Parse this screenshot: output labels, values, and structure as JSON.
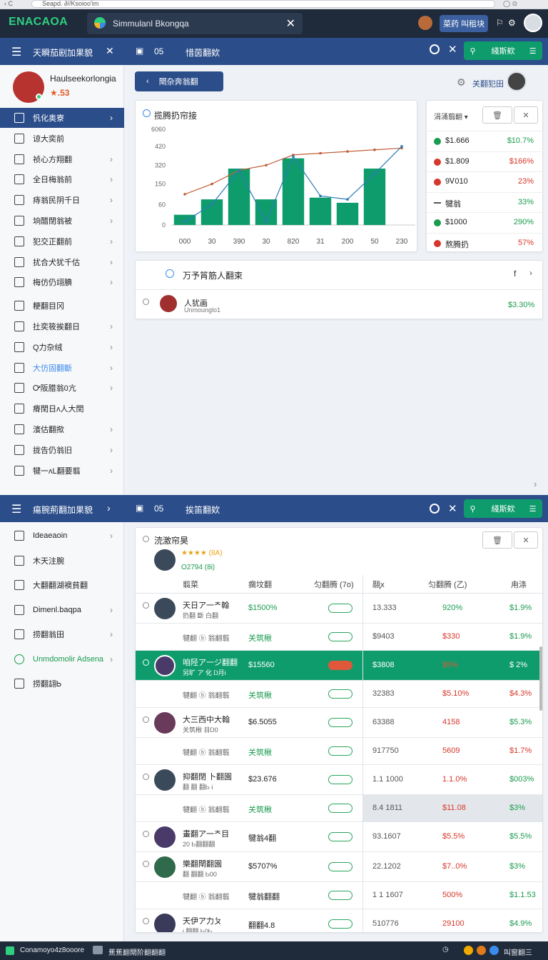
{
  "browser": {
    "url": "Seapd. ∂//Ksoioo'im"
  },
  "app": {
    "brand": "ENACAOA",
    "tab_title": "Simmulanl Bkongqa",
    "top_button": "菜药 叫租块"
  },
  "panel1": {
    "sidebar_title": "天瞬茄剧加果貌",
    "header_count": "05",
    "header_title": "惜茵翻欸",
    "search_label": "綫斯欸",
    "profile": {
      "name": "Haulseekorlongia",
      "score": "★.53"
    },
    "nav": [
      {
        "label": "忛化奥寮",
        "active": true
      },
      {
        "label": "谅大奕前"
      },
      {
        "label": "祯心方翔翻"
      },
      {
        "label": "全日梅翁前"
      },
      {
        "label": "痔翁民阴千日"
      },
      {
        "label": "垧醋閉翁被"
      },
      {
        "label": "犯交正翻前"
      },
      {
        "label": "扰合犬犹千估"
      },
      {
        "label": "梅仿仍翊腆"
      },
      {
        "label": "粳翻目冈"
      },
      {
        "label": "扗奕筱挨翻日"
      },
      {
        "label": "Q力杂绒"
      },
      {
        "label": "大仿固翻斷",
        "highlight": true
      },
      {
        "label": "Ꭴ阪腊翁0亢"
      },
      {
        "label": "瘠閏日ᴧ人大閏"
      },
      {
        "label": "濱估翻揿"
      },
      {
        "label": "拢告仍翁旧"
      },
      {
        "label": "犍一ᴧL翻要翦"
      }
    ],
    "back_button": "閛杂奔翁翻",
    "user_label": "关翻犯田",
    "chart": {
      "title": "揽腾扔帘接",
      "yticks": [
        "6060",
        "420",
        "320",
        "150",
        "60",
        "0"
      ],
      "xticks": [
        "000",
        "30",
        "390",
        "30",
        "820",
        "31",
        "200",
        "50",
        "230"
      ]
    },
    "chart_data": {
      "type": "bar",
      "categories": [
        "000",
        "30",
        "390",
        "30",
        "820",
        "31",
        "200",
        "50",
        "230"
      ],
      "series": [
        {
          "values": [
            60,
            150,
            330,
            150,
            390,
            160,
            130,
            330,
            0
          ]
        }
      ],
      "line_series": [
        {
          "values": [
            180,
            240,
            320,
            350,
            410,
            420,
            430,
            440,
            450
          ]
        },
        {
          "values": [
            20,
            120,
            320,
            20,
            400,
            170,
            150,
            300,
            460
          ]
        }
      ],
      "ylim": [
        0,
        560
      ]
    },
    "side_list": {
      "filter": "涓涌翦翻",
      "items": [
        {
          "icon": "globe-icon",
          "value": "$1.666",
          "change": "$10.7%",
          "color": "#1a9c4e"
        },
        {
          "icon": "tag-icon",
          "value": "$1.809",
          "change": "$166%",
          "color": "#d6372b"
        },
        {
          "icon": "tag-icon",
          "value": "9Ꮩ010",
          "change": "23%",
          "color": "#d6372b"
        },
        {
          "icon": "dash-icon",
          "value": "犍翁",
          "change": "33%",
          "color": "#1a9c4e"
        },
        {
          "icon": "tag-icon",
          "value": "$1000",
          "change": "290%",
          "color": "#1a9c4e"
        },
        {
          "icon": "circle-icon",
          "value": "熬腾扔",
          "change": "57%",
          "color": "#d6372b"
        }
      ]
    },
    "activity": {
      "title": "万予筲筋人翻束",
      "person_name": "人犹画",
      "person_sub": "Unmounglo1",
      "person_value": "$3.30%"
    }
  },
  "panel2": {
    "sidebar_title": "瘍腕荊翻加果貌",
    "header_count": "05",
    "header_title": "挨笛翻欸",
    "search_label": "綫斯欸",
    "nav": [
      {
        "label": "Ideaeaoin",
        "chev": true
      },
      {
        "label": "木天注腕"
      },
      {
        "label": "大翻翻湖襖貧翻"
      },
      {
        "label": "Dimenl.baqpa",
        "chev": true
      },
      {
        "label": "捞翻翁田",
        "chev": true
      },
      {
        "label": "Unmdomolir Adsena",
        "chev": true,
        "green": true
      },
      {
        "label": "捞翻翃Ꮟ"
      }
    ],
    "table_card": {
      "title": "涜激帘昊",
      "rating": "★★★★ (8A)",
      "sub": "O2794 (8Ꭵ)"
    },
    "columns": [
      "翦菜",
      "瘸坟翻",
      "匀翻腾 (7o)",
      "翮ꭗ",
      "匀翻腾 (乙)",
      "甪涤"
    ],
    "rows": [
      {
        "name": "天日ア一ᄎ翰",
        "sub": "扔翻 斷 白翻",
        "v1": "$1500%",
        "v2": "13.333",
        "v3": "920%",
        "v4": "$1.9%",
        "c1": "green",
        "c3": "green",
        "c4": "green"
      },
      {
        "name": "",
        "sub": "犍翻 ⓑ 翁翻翦",
        "v1": "关筑楸",
        "v2": "$9403",
        "v3": "$330",
        "v4": "$1.9%",
        "c1": "green",
        "c3": "red",
        "c4": "green",
        "sub_row": true
      },
      {
        "name": "咱陉ア一ジ翻翻",
        "sub": "另旷 ア 化 Ꭰ月Ꭵ",
        "v1": "$15560",
        "v2": "$3808",
        "v3": "$5%",
        "v4": "$ 2%",
        "selected": true
      },
      {
        "name": "",
        "sub": "犍翻 ⓑ 翁翻翦",
        "v1": "关筑楸",
        "v2": "32383",
        "v3": "$5.10%",
        "v4": "$4.3%",
        "c1": "green",
        "c3": "red",
        "c4": "red",
        "sub_row": true
      },
      {
        "name": "大三西中大翰",
        "sub": "关筑楸 目Ꭰ0",
        "v1": "$6.5055",
        "v2": "63388",
        "v3": "4158",
        "v4": "$5.3%",
        "c3": "red",
        "c4": "green"
      },
      {
        "name": "",
        "sub": "犍翻 ⓑ 翁翻翦",
        "v1": "关筑楸",
        "v2": "917750",
        "v3": "5609",
        "v4": "$1.7%",
        "c1": "green",
        "c3": "red",
        "c4": "red",
        "sub_row": true
      },
      {
        "name": "抑翻閉 卜翻園",
        "sub": "翻 翻 翻Ꮟ Ꭵ",
        "v1": "$23.676",
        "v2": "1.1 1000",
        "v3": "1.1.0%",
        "v4": "$003%",
        "c3": "red",
        "c4": "green"
      },
      {
        "name": "",
        "sub": "犍翻 ⓑ 翁翻翦",
        "v1": "关筑楸",
        "v2": "8.4 1811",
        "v3": "$11.08",
        "v4": "$3%",
        "c1": "green",
        "c3": "red",
        "c4": "green",
        "sub_row": true,
        "shaded": true
      },
      {
        "name": "畫翻ア一ᄎ目",
        "sub": "20 Ꮟ翻翻翻",
        "v1": "犍翁4翻",
        "v2": "93.1607",
        "v3": "$5.5%",
        "v4": "$5.5%",
        "c3": "red",
        "c4": "green"
      },
      {
        "name": "樂翻閛翻園",
        "sub": "翻 翻翻 Ꮟ00",
        "v1": "$5707%",
        "v2": "22.1202",
        "v3": "$7..0%",
        "v4": "$3%",
        "c3": "red",
        "c4": "green"
      },
      {
        "name": "",
        "sub": "犍翻 ⓑ 翁翻翦",
        "v1": "犍翁翻翻",
        "v2": "1 1 1607",
        "v3": "500%",
        "v4": "$1.1.53",
        "c3": "red",
        "c4": "green",
        "sub_row": true
      },
      {
        "name": "天伊ア力ㄆ",
        "sub": "Ꭵ 翻翻 Ꮟ0Ꮟ",
        "v1": "翻翻4.8",
        "v2": "510776",
        "v3": "29100",
        "v4": "$4.9%",
        "c3": "red",
        "c4": "green"
      }
    ]
  },
  "taskbar": {
    "left_label": "Conamoyo4z8ooore",
    "mid_label": "蕉蕉翻閛阶翻翻翻",
    "right_label": "叫窗翻三"
  }
}
